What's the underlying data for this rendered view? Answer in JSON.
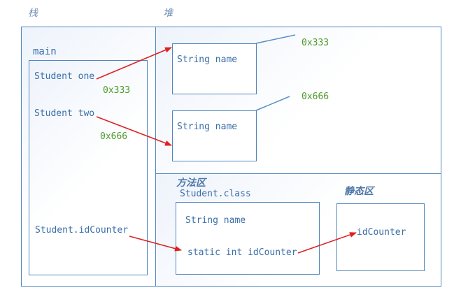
{
  "labels": {
    "stack": "栈",
    "heap": "堆",
    "method_area": "方法区",
    "static_area": "静态区",
    "main": "main",
    "student_one": "Student one",
    "student_two": "Student two",
    "id_counter_ref": "Student.idCounter",
    "heap_obj1_field": "String name",
    "heap_obj2_field": "String name",
    "class_title": "Student.class",
    "class_field": "String name",
    "class_static": "static int idCounter",
    "static_var": "idCounter"
  },
  "addresses": {
    "obj1_near": "0x333",
    "obj1_far": "0x333",
    "obj2_near": "0x666",
    "obj2_far": "0x666"
  },
  "colors": {
    "border": "#4f86bd",
    "text": "#3a6ea8",
    "address": "#4d9a2a",
    "arrow": "#e02020"
  }
}
